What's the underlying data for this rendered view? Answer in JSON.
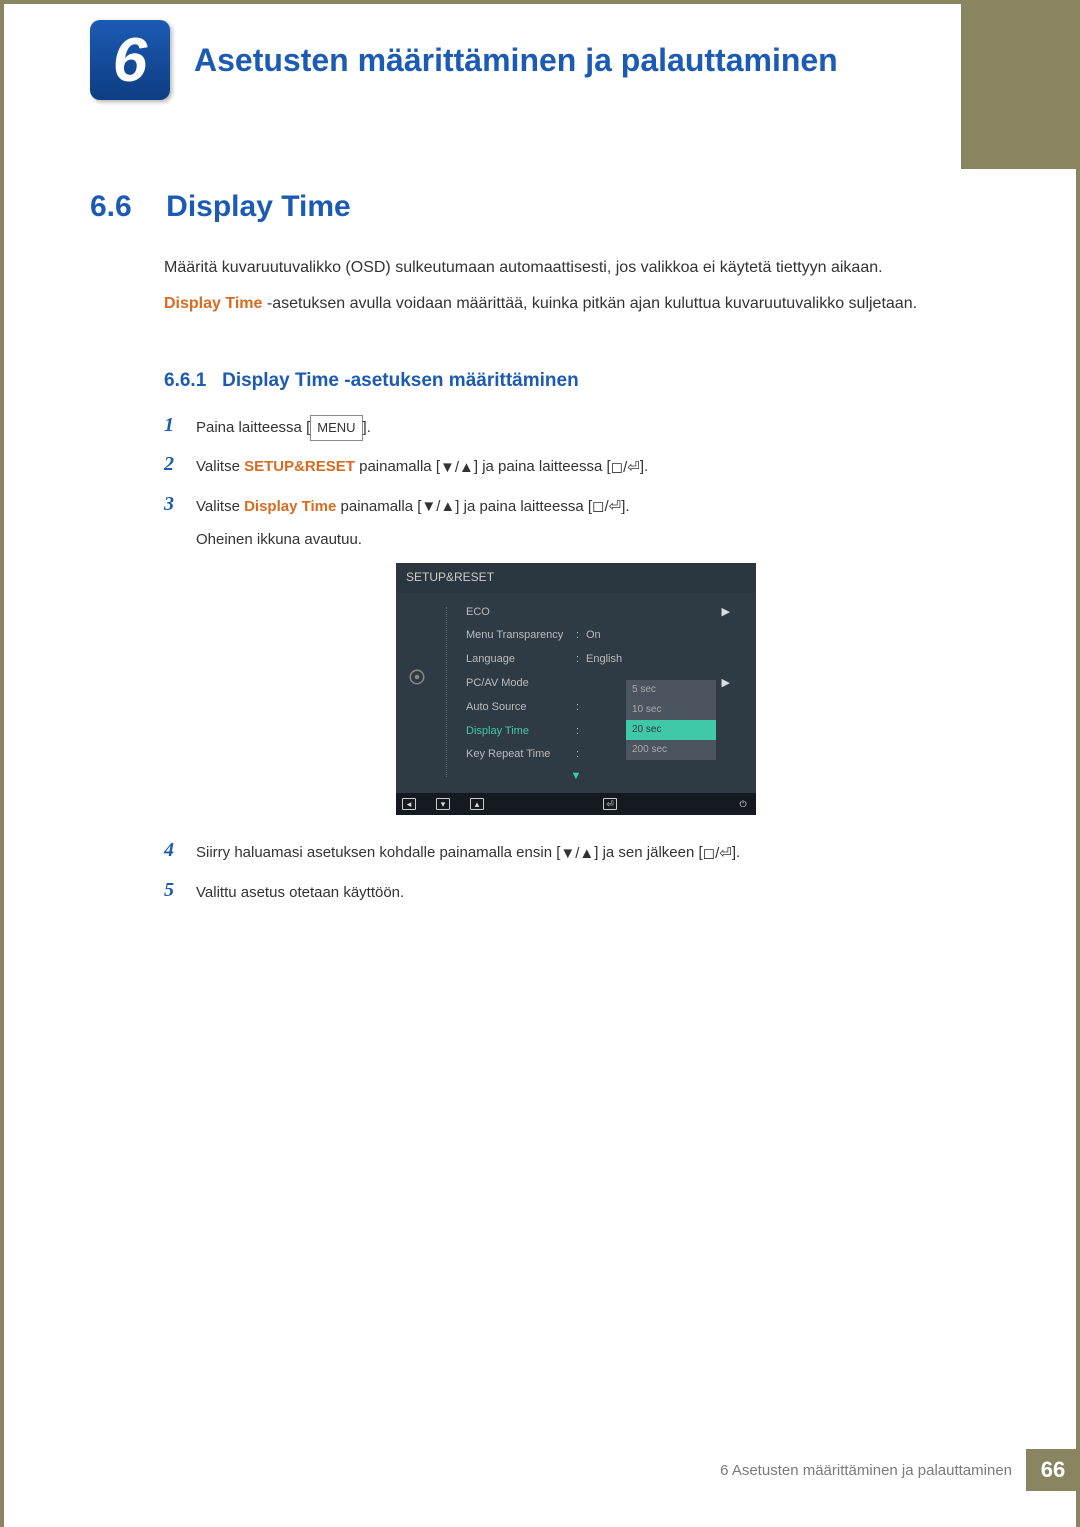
{
  "chapter": {
    "number": "6",
    "title": "Asetusten määrittäminen ja palauttaminen"
  },
  "section": {
    "number": "6.6",
    "title": "Display Time"
  },
  "intro": {
    "p1": "Määritä kuvaruutuvalikko (OSD) sulkeutumaan automaattisesti, jos valikkoa ei käytetä tiettyyn aikaan.",
    "p2_highlight": "Display Time",
    "p2_rest": " -asetuksen avulla voidaan määrittää, kuinka pitkän ajan kuluttua kuvaruutuvalikko suljetaan."
  },
  "subsection": {
    "number": "6.6.1",
    "title": "Display Time -asetuksen määrittäminen"
  },
  "steps": {
    "1": {
      "num": "1",
      "text_a": "Paina laitteessa [",
      "menu": "MENU",
      "text_b": "]."
    },
    "2": {
      "num": "2",
      "text_a": "Valitse ",
      "strong": "SETUP&RESET",
      "text_b": " painamalla [",
      "text_c": "] ja paina laitteessa [",
      "text_d": "]."
    },
    "3": {
      "num": "3",
      "text_a": "Valitse ",
      "strong": "Display Time",
      "text_b": " painamalla [",
      "text_c": "] ja paina laitteessa [",
      "text_d": "].",
      "text_e": "Oheinen ikkuna avautuu."
    },
    "4": {
      "num": "4",
      "text_a": "Siirry haluamasi asetuksen kohdalle painamalla ensin [",
      "text_b": "] ja sen jälkeen [",
      "text_c": "]."
    },
    "5": {
      "num": "5",
      "text_a": "Valittu asetus otetaan käyttöön."
    }
  },
  "osd": {
    "title": "SETUP&RESET",
    "items": [
      {
        "label": "ECO",
        "val": "",
        "arrow": true
      },
      {
        "label": "Menu Transparency",
        "val": "On"
      },
      {
        "label": "Language",
        "val": "English"
      },
      {
        "label": "PC/AV Mode",
        "val": "",
        "arrow": true
      },
      {
        "label": "Auto Source",
        "val": ""
      },
      {
        "label": "Display Time",
        "val": "",
        "active": true
      },
      {
        "label": "Key Repeat Time",
        "val": ""
      }
    ],
    "popup": [
      "5 sec",
      "10 sec",
      "20 sec",
      "200 sec"
    ],
    "popup_selected": "20 sec"
  },
  "footer": {
    "text": "6 Asetusten määrittäminen ja palauttaminen",
    "page": "66"
  }
}
